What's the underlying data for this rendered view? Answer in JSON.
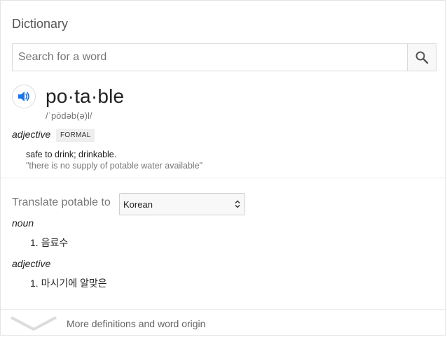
{
  "header": {
    "title": "Dictionary"
  },
  "search": {
    "placeholder": "Search for a word",
    "value": ""
  },
  "entry": {
    "word": "po·ta·ble",
    "phonetic": "/ˈpōdəb(ə)l/",
    "part_of_speech": "adjective",
    "register_badge": "FORMAL",
    "definition": "safe to drink; drinkable.",
    "example": "\"there is no supply of potable water available\""
  },
  "translate": {
    "label": "Translate potable to",
    "language": "Korean",
    "groups": [
      {
        "pos": "noun",
        "items": [
          {
            "num": "1.",
            "text": "음료수"
          }
        ]
      },
      {
        "pos": "adjective",
        "items": [
          {
            "num": "1.",
            "text": "마시기에 알맞은"
          }
        ]
      }
    ]
  },
  "footer": {
    "more_label": "More definitions and word origin"
  },
  "icons": {
    "search": "search-icon",
    "speaker": "speaker-icon",
    "chevron": "chevron-down-icon",
    "select_arrows": "select-arrows-icon"
  },
  "colors": {
    "accent": "#1a73e8",
    "badge_bg": "#eeeeee"
  }
}
